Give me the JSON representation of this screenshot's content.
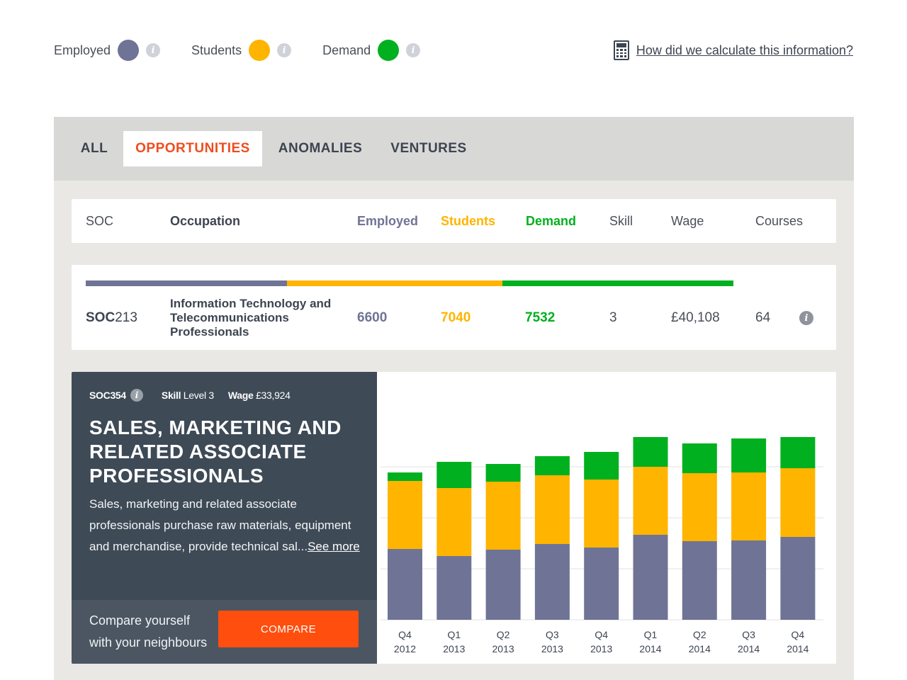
{
  "legend": {
    "items": [
      {
        "label": "Employed",
        "color": "#6f7496"
      },
      {
        "label": "Students",
        "color": "#ffb400"
      },
      {
        "label": "Demand",
        "color": "#00b01e"
      }
    ],
    "info_icon": "info-icon"
  },
  "calc_link": {
    "icon": "calculator-icon",
    "label": "How did we calculate this information?"
  },
  "tabs": [
    {
      "label": "ALL",
      "active": false
    },
    {
      "label": "OPPORTUNITIES",
      "active": true
    },
    {
      "label": "ANOMALIES",
      "active": false
    },
    {
      "label": "VENTURES",
      "active": false
    }
  ],
  "table": {
    "headers": {
      "soc": "SOC",
      "occupation": "Occupation",
      "employed": "Employed",
      "students": "Students",
      "demand": "Demand",
      "skill": "Skill",
      "wage": "Wage",
      "courses": "Courses"
    },
    "row": {
      "soc_prefix": "SOC",
      "soc_code": "213",
      "occupation_lines": [
        "Information Technology and",
        "Telecommunications",
        "Professionals"
      ],
      "employed": "6600",
      "students": "7040",
      "demand": "7532",
      "skill": "3",
      "wage": "£40,108",
      "courses": "64",
      "bar_shares": [
        0.32,
        0.34,
        0.36
      ]
    }
  },
  "detail": {
    "soc": "SOC354",
    "skill_label": "Skill",
    "skill_value": "Level 3",
    "wage_label": "Wage",
    "wage_value": "£33,924",
    "title_lines": [
      "SALES, MARKETING AND",
      "RELATED ASSOCIATE",
      "PROFESSIONALS"
    ],
    "description": "Sales, marketing and related associate professionals purchase raw materials, equipment and merchandise, provide technical sal...",
    "see_more": "See more",
    "compare_text_lines": [
      "Compare yourself",
      "with your neighbours"
    ],
    "compare_button": "COMPARE"
  },
  "chart_data": {
    "type": "bar",
    "stacked": true,
    "categories": [
      [
        "Q4",
        "2012"
      ],
      [
        "Q1",
        "2013"
      ],
      [
        "Q2",
        "2013"
      ],
      [
        "Q3",
        "2013"
      ],
      [
        "Q4",
        "2013"
      ],
      [
        "Q1",
        "2014"
      ],
      [
        "Q2",
        "2014"
      ],
      [
        "Q3",
        "2014"
      ],
      [
        "Q4",
        "2014"
      ]
    ],
    "series": [
      {
        "name": "Employed",
        "color": "#6f7496",
        "values": [
          100,
          90,
          99,
          107,
          102,
          120,
          111,
          112,
          117
        ]
      },
      {
        "name": "Students",
        "color": "#ffb400",
        "values": [
          96,
          96,
          96,
          97,
          96,
          96,
          96,
          96,
          97
        ]
      },
      {
        "name": "Demand",
        "color": "#00b01e",
        "values": [
          12,
          37,
          25,
          27,
          39,
          42,
          42,
          48,
          44
        ]
      }
    ],
    "ylim": [
      0,
      270
    ],
    "gridlines": [
      72,
      144,
      216
    ],
    "grid": true
  }
}
